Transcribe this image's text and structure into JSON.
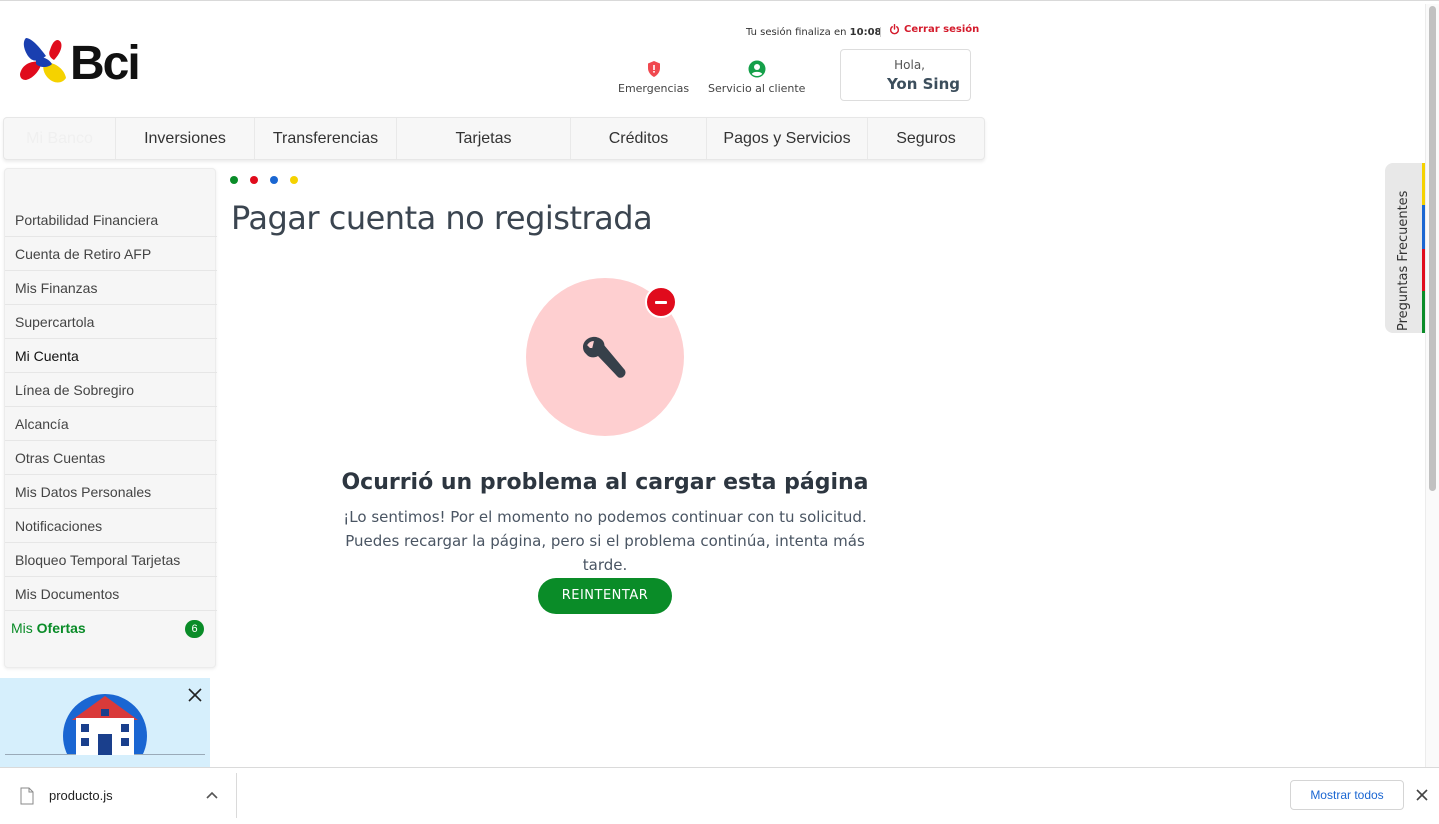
{
  "brand": {
    "name": "Bci",
    "colors": {
      "green": "#0a8c28",
      "red": "#e00b1c",
      "blue": "#1a66d2",
      "yellow": "#f5d200"
    }
  },
  "header": {
    "session_prefix": "Tu sesión finaliza en",
    "session_time": "10:08",
    "logout_label": "Cerrar sesión",
    "emergencias_label": "Emergencias",
    "servicio_label": "Servicio al cliente",
    "greeting": "Hola,",
    "user_name": "Yon Sing"
  },
  "nav": {
    "items": [
      {
        "label": "Mi Banco"
      },
      {
        "label": "Inversiones"
      },
      {
        "label": "Transferencias"
      },
      {
        "label": "Tarjetas"
      },
      {
        "label": "Créditos"
      },
      {
        "label": "Pagos y Servicios"
      },
      {
        "label": "Seguros"
      }
    ]
  },
  "sidebar": {
    "items": [
      {
        "label": "Portabilidad Financiera"
      },
      {
        "label": "Cuenta de Retiro AFP"
      },
      {
        "label": "Mis Finanzas"
      },
      {
        "label": "Supercartola"
      },
      {
        "label": "Mi Cuenta"
      },
      {
        "label": "Línea de Sobregiro"
      },
      {
        "label": "Alcancía"
      },
      {
        "label": "Otras Cuentas"
      },
      {
        "label": "Mis Datos Personales"
      },
      {
        "label": "Notificaciones"
      },
      {
        "label": "Bloqueo Temporal Tarjetas"
      },
      {
        "label": "Mis Documentos"
      }
    ],
    "offers_prefix": "Mis",
    "offers_label": "Ofertas",
    "offers_count": "6"
  },
  "main": {
    "title": "Pagar cuenta no registrada",
    "error_title": "Ocurrió un problema al cargar esta página",
    "error_message": "¡Lo sentimos! Por el momento no podemos continuar con tu solicitud. Puedes recargar la página, pero si el problema continúa, intenta más tarde.",
    "retry_label": "REINTENTAR"
  },
  "faq": {
    "label": "Preguntas Frecuentes"
  },
  "download_bar": {
    "file_name": "producto.js",
    "show_all_label": "Mostrar todos"
  }
}
